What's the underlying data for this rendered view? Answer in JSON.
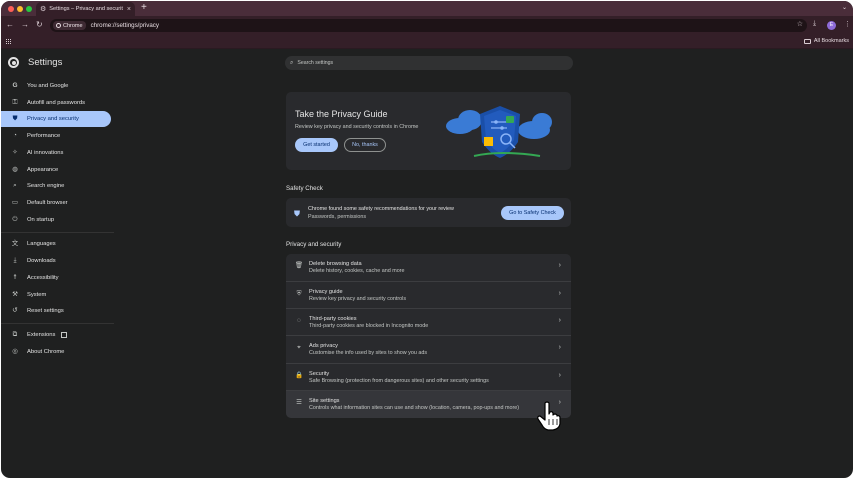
{
  "browser": {
    "tab_title": "Settings – Privacy and securit",
    "chip_label": "Chrome",
    "url": "chrome://settings/privacy",
    "avatar_letter": "E",
    "all_bookmarks": "All Bookmarks"
  },
  "sidebar": {
    "title": "Settings",
    "items": [
      {
        "label": "You and Google",
        "icon": "google-icon"
      },
      {
        "label": "Autofill and passwords",
        "icon": "key-icon"
      },
      {
        "label": "Privacy and security",
        "icon": "shield-icon",
        "active": true
      },
      {
        "label": "Performance",
        "icon": "speedometer-icon"
      },
      {
        "label": "AI innovations",
        "icon": "sparkle-icon"
      },
      {
        "label": "Appearance",
        "icon": "palette-icon"
      },
      {
        "label": "Search engine",
        "icon": "search-icon"
      },
      {
        "label": "Default browser",
        "icon": "browser-icon"
      },
      {
        "label": "On startup",
        "icon": "power-icon"
      },
      {
        "label": "Languages",
        "icon": "translate-icon"
      },
      {
        "label": "Downloads",
        "icon": "download-icon"
      },
      {
        "label": "Accessibility",
        "icon": "accessibility-icon"
      },
      {
        "label": "System",
        "icon": "wrench-icon"
      },
      {
        "label": "Reset settings",
        "icon": "reset-icon"
      },
      {
        "label": "Extensions",
        "icon": "puzzle-icon"
      },
      {
        "label": "About Chrome",
        "icon": "chrome-icon"
      }
    ]
  },
  "search": {
    "placeholder": "Search settings"
  },
  "privacy_guide": {
    "title": "Take the Privacy Guide",
    "subtitle": "Review key privacy and security controls in Chrome",
    "primary_button": "Get started",
    "secondary_button": "No, thanks"
  },
  "safety_check": {
    "heading": "Safety Check",
    "line1": "Chrome found some safety recommendations for your review",
    "line2": "Passwords, permissions",
    "button": "Go to Safety Check"
  },
  "privacy_section": {
    "heading": "Privacy and security",
    "rows": [
      {
        "title": "Delete browsing data",
        "subtitle": "Delete history, cookies, cache and more",
        "icon": "trash-icon"
      },
      {
        "title": "Privacy guide",
        "subtitle": "Review key privacy and security controls",
        "icon": "privacy-guide-icon"
      },
      {
        "title": "Third-party cookies",
        "subtitle": "Third-party cookies are blocked in Incognito mode",
        "icon": "cookie-icon"
      },
      {
        "title": "Ads privacy",
        "subtitle": "Customise the info used by sites to show you ads",
        "icon": "ads-icon"
      },
      {
        "title": "Security",
        "subtitle": "Safe Browsing (protection from dangerous sites) and other security settings",
        "icon": "lock-icon"
      },
      {
        "title": "Site settings",
        "subtitle": "Controls what information sites can use and show (location, camera, pop-ups and more)",
        "icon": "sliders-icon"
      }
    ]
  },
  "colors": {
    "accent": "#a8c7fa",
    "frame": "#341f28",
    "background": "#1f2020",
    "card": "#292a2d"
  }
}
